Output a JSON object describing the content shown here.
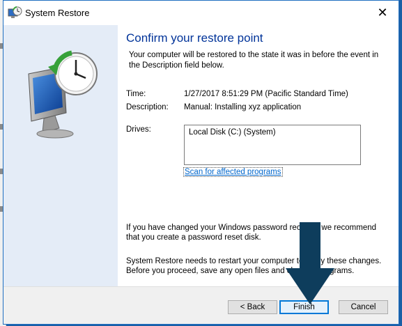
{
  "window": {
    "title": "System Restore",
    "close_glyph": "✕",
    "icon": "system-restore-icon"
  },
  "content": {
    "heading": "Confirm your restore point",
    "intro": "Your computer will be restored to the state it was in before the event in the Description field below.",
    "time_label": "Time:",
    "time_value": "1/27/2017 8:51:29 PM (Pacific Standard Time)",
    "description_label": "Description:",
    "description_value": "Manual: Installing xyz application",
    "drives_label": "Drives:",
    "drives": [
      "Local Disk (C:) (System)"
    ],
    "scan_link": "Scan for affected programs",
    "password_note": "If you have changed your Windows password recently, we recommend that you create a password reset disk.",
    "restart_note": "System Restore needs to restart your computer to apply these changes. Before you proceed, save any open files and close all programs."
  },
  "footer": {
    "back_label": "< Back",
    "finish_label": "Finish",
    "cancel_label": "Cancel"
  },
  "colors": {
    "heading": "#003399",
    "link": "#0066cc",
    "side_panel": "#e4ecf7",
    "annotation_arrow": "#0e3d5c"
  }
}
